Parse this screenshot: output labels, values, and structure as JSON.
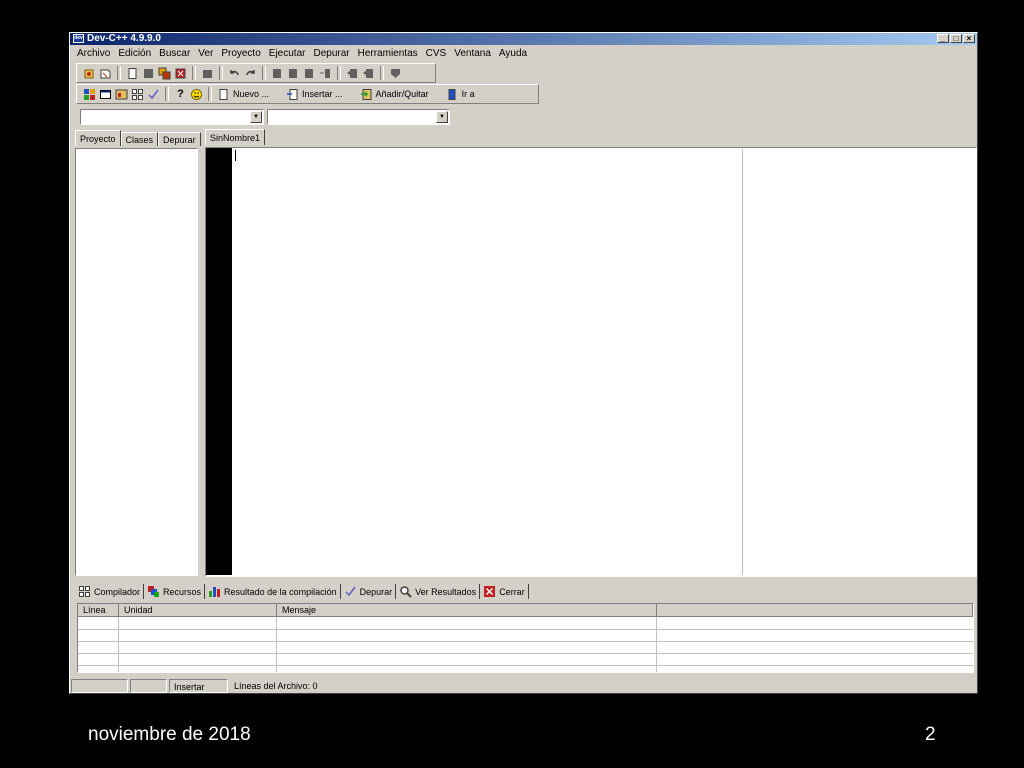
{
  "window": {
    "title": "Dev-C++ 4.9.9.0",
    "app_icon": "dev",
    "min": "_",
    "max": "□",
    "close": "×"
  },
  "menu": [
    "Archivo",
    "Edición",
    "Buscar",
    "Ver",
    "Proyecto",
    "Ejecutar",
    "Depurar",
    "Herramientas",
    "CVS",
    "Ventana",
    "Ayuda"
  ],
  "toolbar2": {
    "nuevo": "Nuevo ...",
    "insertar": "Insertar ...",
    "anadir": "Añadir/Quitar",
    "ira": "Ir a"
  },
  "left_tabs": [
    "Proyecto",
    "Clases",
    "Depurar"
  ],
  "editor_tab": "SinNombre1",
  "bottom_tabs": [
    "Compilador",
    "Recursos",
    "Resultado de la compilación",
    "Depurar",
    "Ver Resultados",
    "Cerrar"
  ],
  "grid_headers": [
    "Línea",
    "Unidad",
    "Mensaje"
  ],
  "status": {
    "mode": "Insertar",
    "lines": "Líneas del Archivo: 0"
  },
  "footer": {
    "date": "noviembre de 2018",
    "page": "2"
  }
}
